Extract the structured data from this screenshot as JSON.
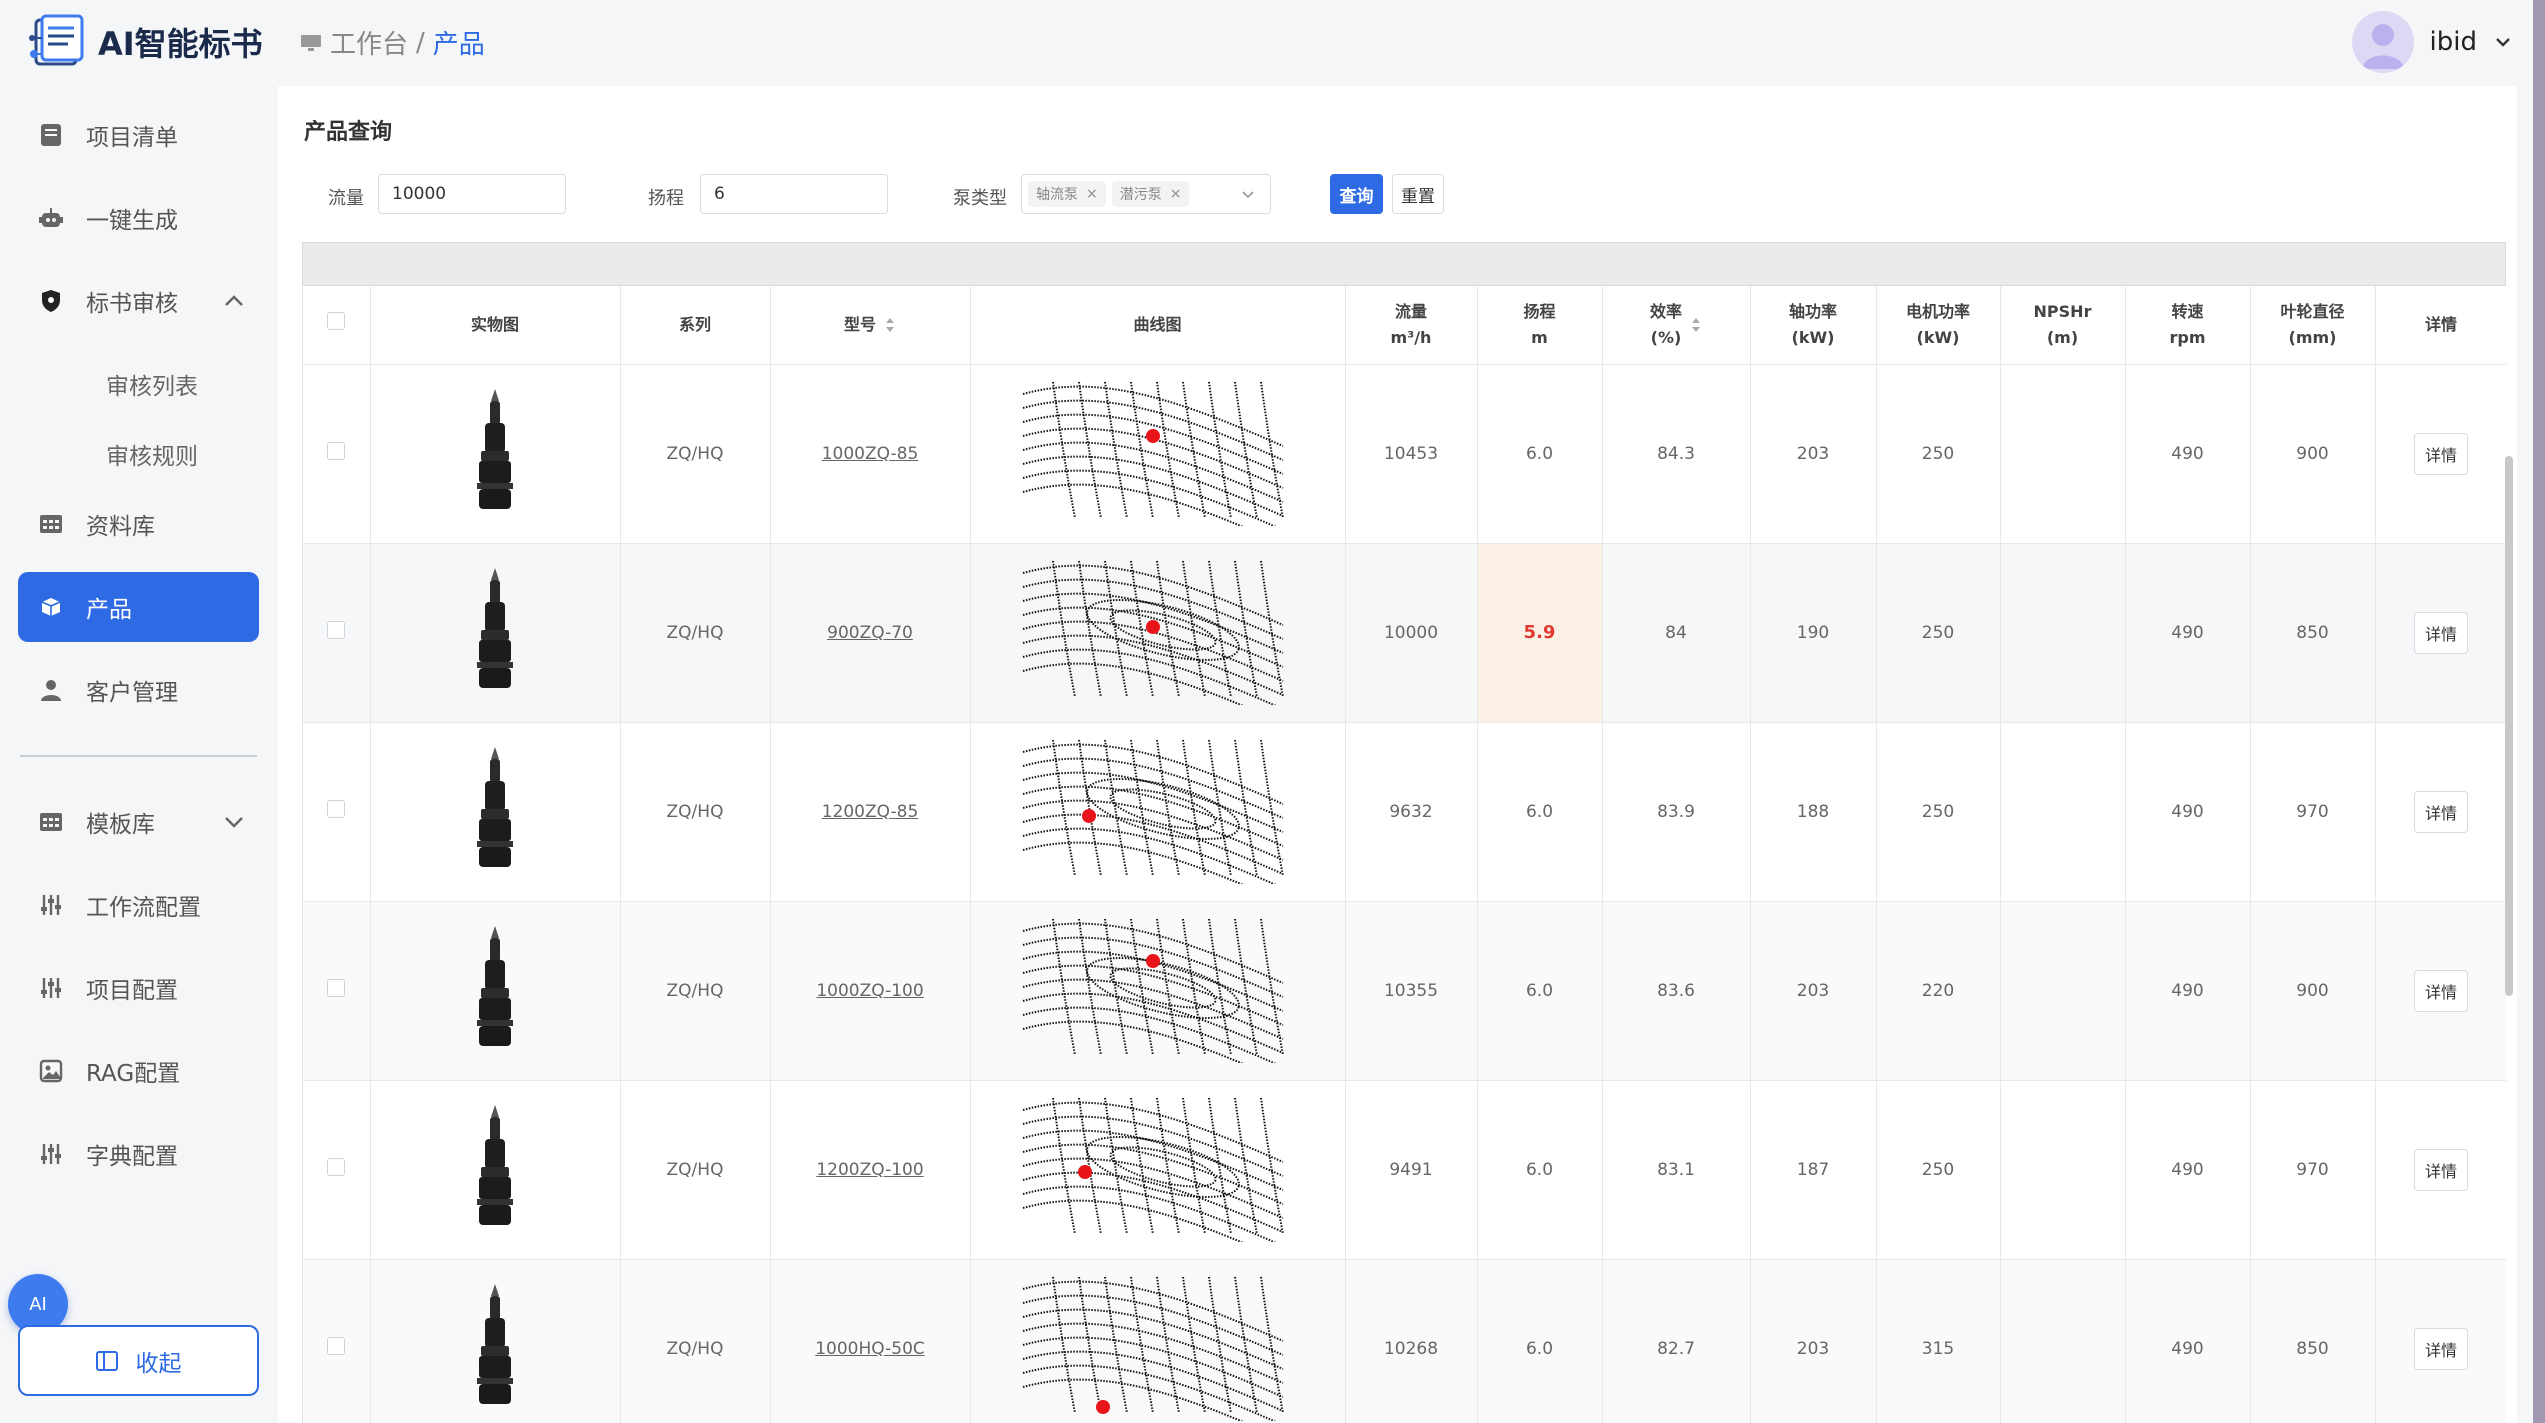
{
  "app": {
    "name": "AI智能标书"
  },
  "breadcrumb": {
    "home": "工作台",
    "separator": "/",
    "current": "产品"
  },
  "user": {
    "name": "ibid"
  },
  "sidebar": {
    "items": [
      {
        "label": "项目清单",
        "icon": "document-icon"
      },
      {
        "label": "一键生成",
        "icon": "robot-icon"
      },
      {
        "label": "标书审核",
        "icon": "shield-icon",
        "expanded": true
      },
      {
        "label": "审核列表"
      },
      {
        "label": "审核规则"
      },
      {
        "label": "资料库",
        "icon": "grid-icon"
      },
      {
        "label": "产品",
        "icon": "cube-icon",
        "active": true
      },
      {
        "label": "客户管理",
        "icon": "user-icon"
      },
      {
        "label": "模板库",
        "icon": "grid-icon",
        "expanded": false
      },
      {
        "label": "工作流配置",
        "icon": "sliders-icon"
      },
      {
        "label": "项目配置",
        "icon": "sliders-icon"
      },
      {
        "label": "RAG配置",
        "icon": "image-icon"
      },
      {
        "label": "字典配置",
        "icon": "sliders-icon"
      }
    ],
    "ai_label": "AI",
    "collapse_label": "收起"
  },
  "query": {
    "title": "产品查询",
    "flow_label": "流量",
    "flow_value": "10000",
    "head_label": "扬程",
    "head_value": "6",
    "pump_type_label": "泵类型",
    "pump_types": [
      "轴流泵",
      "潜污泵"
    ],
    "search_label": "查询",
    "reset_label": "重置"
  },
  "table": {
    "headers": {
      "photo": "实物图",
      "series": "系列",
      "model": "型号",
      "curve": "曲线图",
      "flow": "流量",
      "flow_unit": "m³/h",
      "head": "扬程",
      "head_unit": "m",
      "eff": "效率",
      "eff_unit": "(%)",
      "shaft": "轴功率",
      "shaft_unit": "(kW)",
      "motor": "电机功率",
      "motor_unit": "(kW)",
      "npsh": "NPSHr",
      "npsh_unit": "(m)",
      "speed": "转速",
      "speed_unit": "rpm",
      "impeller": "叶轮直径",
      "impeller_unit": "(mm)",
      "detail": "详情"
    },
    "rows": [
      {
        "series": "ZQ/HQ",
        "model": "1000ZQ-85",
        "flow": "10453",
        "head": "6.0",
        "eff": "84.3",
        "shaft": "203",
        "motor": "250",
        "npsh": "",
        "speed": "490",
        "impeller": "900",
        "detail": "详情",
        "highlight_head": false
      },
      {
        "series": "ZQ/HQ",
        "model": "900ZQ-70",
        "flow": "10000",
        "head": "5.9",
        "eff": "84",
        "shaft": "190",
        "motor": "250",
        "npsh": "",
        "speed": "490",
        "impeller": "850",
        "detail": "详情",
        "highlight_head": true
      },
      {
        "series": "ZQ/HQ",
        "model": "1200ZQ-85",
        "flow": "9632",
        "head": "6.0",
        "eff": "83.9",
        "shaft": "188",
        "motor": "250",
        "npsh": "",
        "speed": "490",
        "impeller": "970",
        "detail": "详情",
        "highlight_head": false
      },
      {
        "series": "ZQ/HQ",
        "model": "1000ZQ-100",
        "flow": "10355",
        "head": "6.0",
        "eff": "83.6",
        "shaft": "203",
        "motor": "220",
        "npsh": "",
        "speed": "490",
        "impeller": "900",
        "detail": "详情",
        "highlight_head": false
      },
      {
        "series": "ZQ/HQ",
        "model": "1200ZQ-100",
        "flow": "9491",
        "head": "6.0",
        "eff": "83.1",
        "shaft": "187",
        "motor": "250",
        "npsh": "",
        "speed": "490",
        "impeller": "970",
        "detail": "详情",
        "highlight_head": false
      },
      {
        "series": "ZQ/HQ",
        "model": "1000HQ-50C",
        "flow": "10268",
        "head": "6.0",
        "eff": "82.7",
        "shaft": "203",
        "motor": "315",
        "npsh": "",
        "speed": "490",
        "impeller": "850",
        "detail": "详情",
        "highlight_head": false
      }
    ]
  },
  "colors": {
    "accent": "#2d6ae3",
    "highlight_bg": "#fbf0e6",
    "highlight_text": "#e03a2f",
    "operating_point": "#e8141a"
  }
}
